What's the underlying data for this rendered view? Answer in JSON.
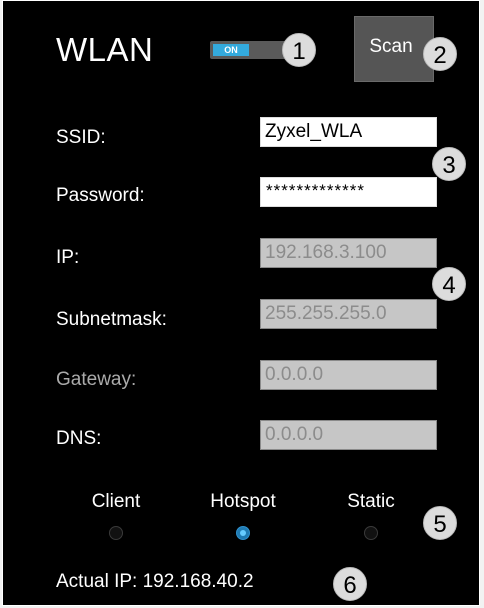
{
  "header": {
    "title": "WLAN",
    "toggle_label": "ON",
    "scan_label": "Scan"
  },
  "callouts": [
    "1",
    "2",
    "3",
    "4",
    "5",
    "6"
  ],
  "fields": {
    "ssid": {
      "label": "SSID:",
      "value": "Zyxel_WLA"
    },
    "password": {
      "label": "Password:",
      "value": "*************"
    },
    "ip": {
      "label": "IP:",
      "value": "192.168.3.100"
    },
    "subnetmask": {
      "label": "Subnetmask:",
      "value": "255.255.255.0"
    },
    "gateway": {
      "label": "Gateway:",
      "value": "0.0.0.0"
    },
    "dns": {
      "label": "DNS:",
      "value": "0.0.0.0"
    }
  },
  "modes": {
    "options": [
      "Client",
      "Hotspot",
      "Static"
    ],
    "selected": "Hotspot"
  },
  "status": {
    "actual_ip": "Actual IP: 192.168.40.2"
  },
  "colors": {
    "background": "#000000",
    "accent": "#33aadd",
    "button": "#555555",
    "readonly_field": "#c6c6c6"
  }
}
